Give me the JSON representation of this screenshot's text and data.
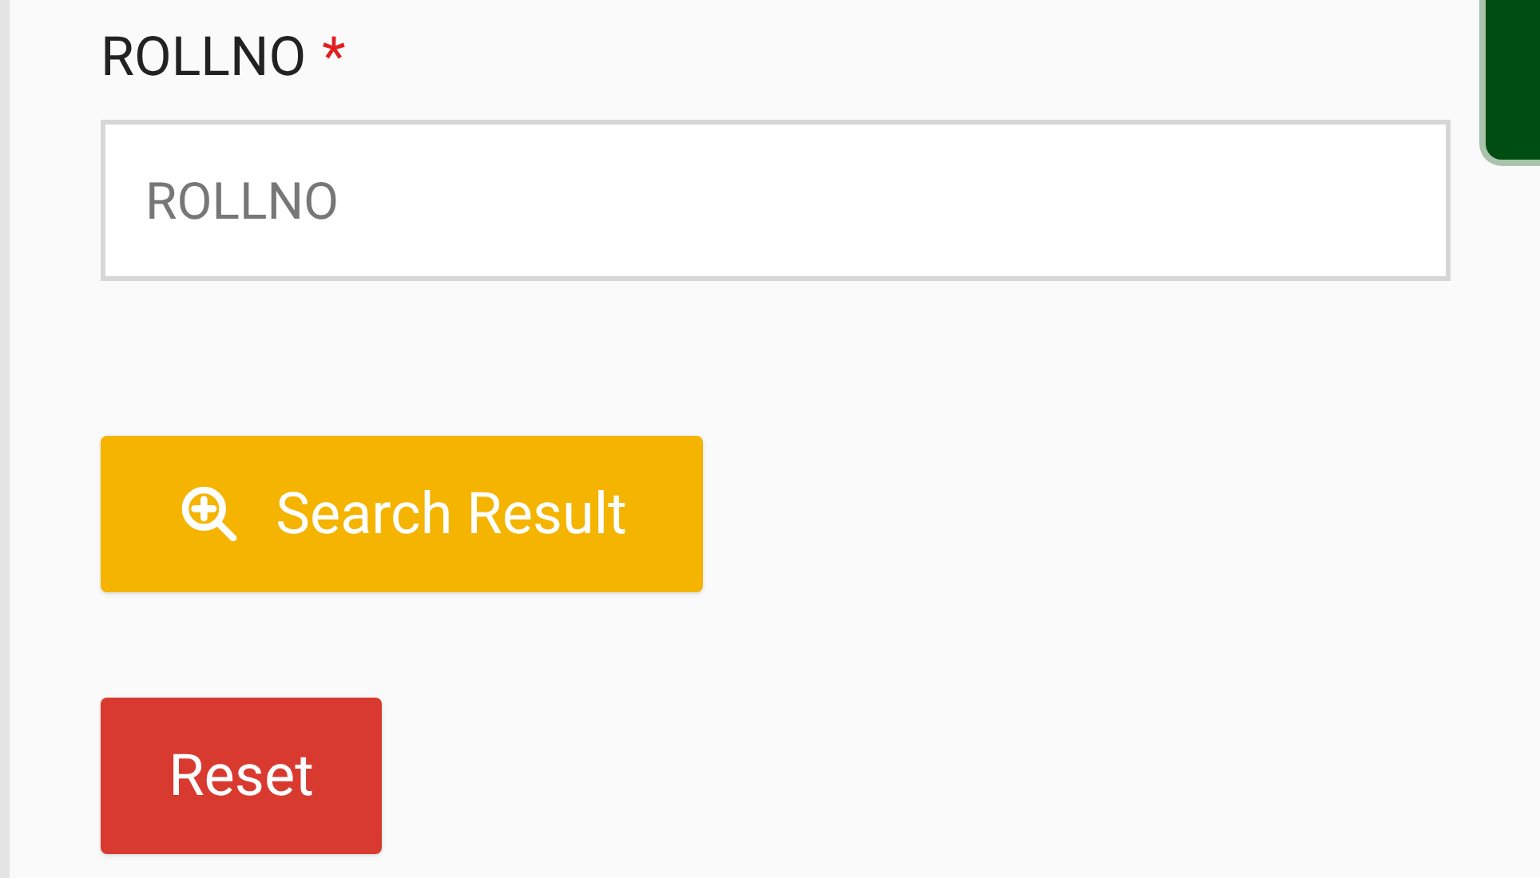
{
  "field": {
    "label": "ROLLNO",
    "required_mark": "*",
    "placeholder": "ROLLNO"
  },
  "buttons": [
    {
      "kind": "search",
      "label": "Search Result"
    },
    {
      "kind": "reset",
      "label": "Reset"
    }
  ]
}
